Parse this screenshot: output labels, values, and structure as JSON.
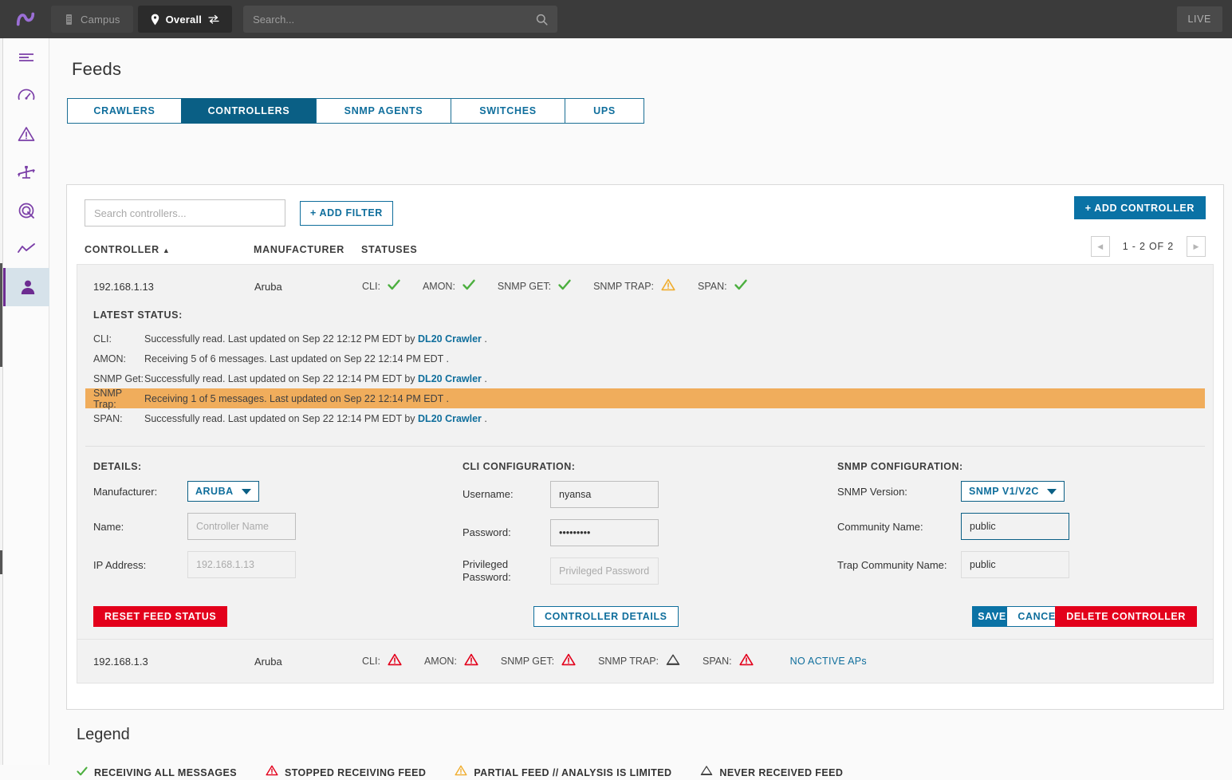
{
  "topbar": {
    "logo_icon": "nyansa-logo-icon",
    "campus_label": "Campus",
    "campus_icon": "building-icon",
    "overall_label": "Overall",
    "overall_icon": "location-pin-icon",
    "overall_swap_icon": "swap-arrows-icon",
    "search_placeholder": "Search...",
    "search_value": "",
    "search_icon": "search-icon",
    "live_label": "LIVE"
  },
  "sidebar": {
    "items": [
      {
        "name": "menu",
        "icon": "hamburger-menu-icon",
        "active": false
      },
      {
        "name": "dashboard",
        "icon": "gauge-icon",
        "active": false
      },
      {
        "name": "alerts",
        "icon": "warning-triangle-icon",
        "active": false
      },
      {
        "name": "balance",
        "icon": "scale-balance-icon",
        "active": false
      },
      {
        "name": "radar",
        "icon": "target-radar-icon",
        "active": false
      },
      {
        "name": "trends",
        "icon": "line-chart-icon",
        "active": false
      },
      {
        "name": "admin",
        "icon": "person-icon",
        "active": true
      }
    ]
  },
  "page": {
    "title": "Feeds",
    "tabs": [
      {
        "label": "CRAWLERS",
        "active": false
      },
      {
        "label": "CONTROLLERS",
        "active": true
      },
      {
        "label": "SNMP AGENTS",
        "active": false
      },
      {
        "label": "SWITCHES",
        "active": false
      },
      {
        "label": "UPS",
        "active": false
      }
    ]
  },
  "toolbar": {
    "search_placeholder": "Search controllers...",
    "search_value": "",
    "add_filter_label": "+ ADD FILTER",
    "add_controller_label": "+ ADD CONTROLLER"
  },
  "table": {
    "headers": {
      "controller": "CONTROLLER",
      "sort_caret": "▲",
      "manufacturer": "MANUFACTURER",
      "statuses": "STATUSES"
    },
    "pagination": {
      "prev_icon": "chevron-left-icon",
      "next_icon": "chevron-right-icon",
      "range_label": "1 - 2  OF  2"
    }
  },
  "row1": {
    "ip": "192.168.1.13",
    "manufacturer": "Aruba",
    "statuses": [
      {
        "label": "CLI:",
        "state": "ok"
      },
      {
        "label": "AMON:",
        "state": "ok"
      },
      {
        "label": "SNMP GET:",
        "state": "ok"
      },
      {
        "label": "SNMP TRAP:",
        "state": "partial"
      },
      {
        "label": "SPAN:",
        "state": "ok"
      }
    ],
    "latest_status_title": "LATEST STATUS:",
    "latest_status": [
      {
        "key": "CLI:",
        "text_before": "Successfully read. Last updated on Sep 22 12:12 PM EDT by ",
        "link": "DL20 Crawler",
        "text_after": " .",
        "warn": false
      },
      {
        "key": "AMON:",
        "text_before": "Receiving 5 of 6 messages. Last updated on Sep 22 12:14 PM EDT .",
        "link": "",
        "text_after": "",
        "warn": false
      },
      {
        "key": "SNMP Get:",
        "text_before": "Successfully read. Last updated on Sep 22 12:14 PM EDT by ",
        "link": "DL20 Crawler",
        "text_after": " .",
        "warn": false
      },
      {
        "key": "SNMP Trap:",
        "text_before": "Receiving 1 of 5 messages. Last updated on Sep 22 12:14 PM EDT .",
        "link": "",
        "text_after": "",
        "warn": true
      },
      {
        "key": "SPAN:",
        "text_before": "Successfully read. Last updated on Sep 22 12:14 PM EDT by ",
        "link": "DL20 Crawler",
        "text_after": " .",
        "warn": false
      }
    ],
    "details": {
      "title": "DETAILS:",
      "manufacturer_label": "Manufacturer:",
      "manufacturer_value": "ARUBA",
      "name_label": "Name:",
      "name_value": "",
      "name_placeholder": "Controller Name",
      "ip_label": "IP Address:",
      "ip_value": "",
      "ip_placeholder": "192.168.1.13"
    },
    "cli": {
      "title": "CLI CONFIGURATION:",
      "username_label": "Username:",
      "username_value": "nyansa",
      "password_label": "Password:",
      "password_value": "•••••••••",
      "privileged_label": "Privileged Password:",
      "privileged_value": "",
      "privileged_placeholder": "Privileged Password"
    },
    "snmp": {
      "title": "SNMP CONFIGURATION:",
      "version_label": "SNMP Version:",
      "version_value": "SNMP V1/V2C",
      "community_label": "Community Name:",
      "community_value": "public",
      "trap_community_label": "Trap Community Name:",
      "trap_community_value": "public"
    },
    "buttons": {
      "reset": "RESET FEED STATUS",
      "controller_details": "CONTROLLER DETAILS",
      "save": "SAVE",
      "cancel": "CANCEL",
      "delete": "DELETE CONTROLLER"
    }
  },
  "row2": {
    "ip": "192.168.1.3",
    "manufacturer": "Aruba",
    "statuses": [
      {
        "label": "CLI:",
        "state": "stopped"
      },
      {
        "label": "AMON:",
        "state": "stopped"
      },
      {
        "label": "SNMP GET:",
        "state": "stopped"
      },
      {
        "label": "SNMP TRAP:",
        "state": "never"
      },
      {
        "label": "SPAN:",
        "state": "stopped"
      }
    ],
    "note": "NO ACTIVE APs"
  },
  "legend": {
    "title": "Legend",
    "items": [
      {
        "state": "ok",
        "label": "RECEIVING ALL MESSAGES"
      },
      {
        "state": "stopped",
        "label": "STOPPED RECEIVING FEED"
      },
      {
        "state": "partial",
        "label": "PARTIAL FEED // ANALYSIS IS LIMITED"
      },
      {
        "state": "never",
        "label": "NEVER RECEIVED FEED"
      }
    ]
  },
  "colors": {
    "ok": "#4caf3f",
    "stopped": "#e3001b",
    "partial": "#f0ad2e",
    "never": "#3d3d3d",
    "accent": "#0f6e9c",
    "tab_active": "#0a5f85",
    "danger": "#e3001b",
    "purple": "#7b3fa8",
    "warn_row_bg": "#f0ad5c"
  }
}
